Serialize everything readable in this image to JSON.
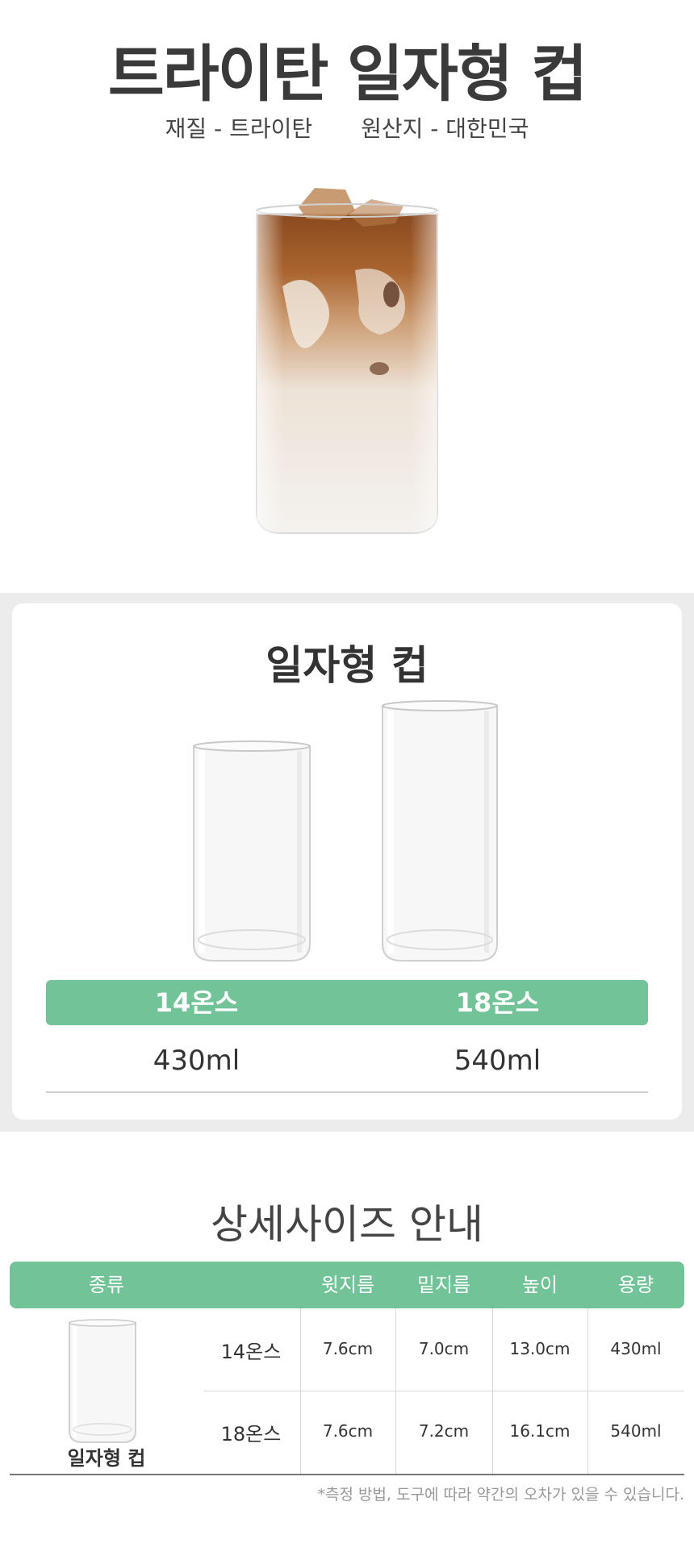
{
  "header": {
    "title": "트라이탄 일자형 컵",
    "material": "재질 - 트라이탄",
    "origin": "원산지 - 대한민국"
  },
  "sizes_card": {
    "title": "일자형 컵",
    "options": [
      {
        "name": "14온스",
        "volume": "430ml"
      },
      {
        "name": "18온스",
        "volume": "540ml"
      }
    ]
  },
  "detail": {
    "title": "상세사이즈 안내",
    "columns": [
      "종류",
      "윗지름",
      "밑지름",
      "높이",
      "용량"
    ],
    "product_label": "일자형 컵",
    "rows": [
      {
        "name": "14온스",
        "top": "7.6cm",
        "bottom": "7.0cm",
        "height": "13.0cm",
        "capacity": "430ml"
      },
      {
        "name": "18온스",
        "top": "7.6cm",
        "bottom": "7.2cm",
        "height": "16.1cm",
        "capacity": "540ml"
      }
    ],
    "note": "*측정 방법, 도구에 따라 약간의 오차가 있을 수 있습니다."
  },
  "colors": {
    "accent_green": "#72c397",
    "band_gray": "#ececec",
    "text_dark": "#333333"
  }
}
